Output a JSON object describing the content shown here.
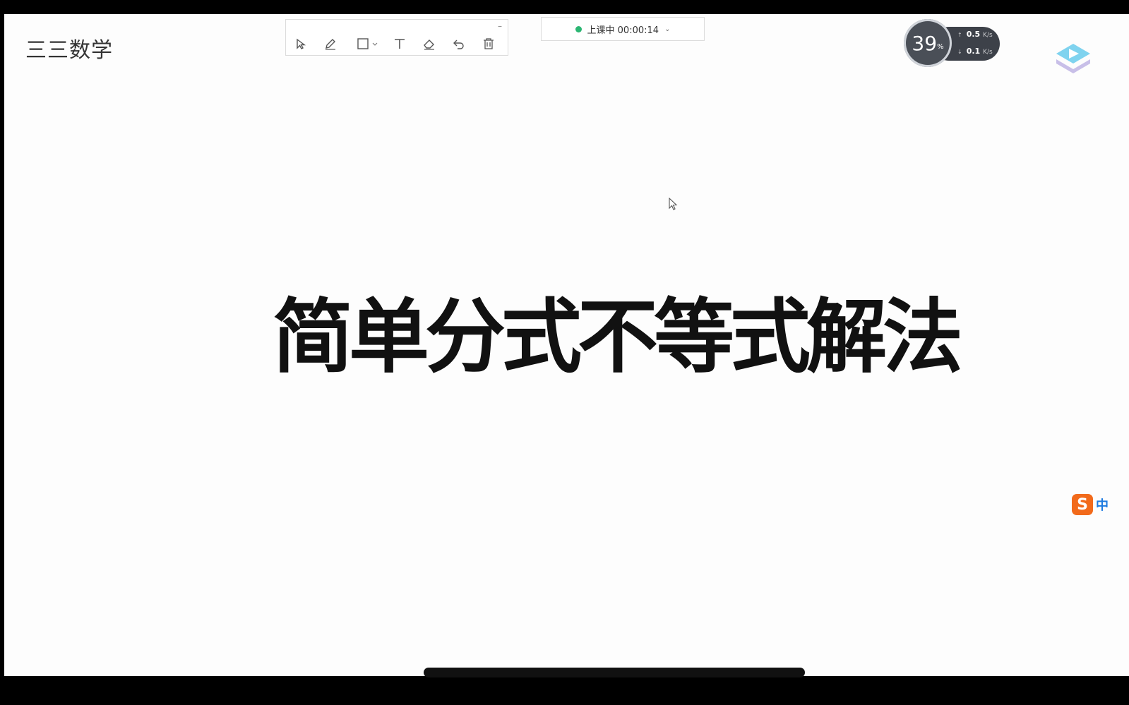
{
  "app": {
    "brand": "三三数学",
    "slide_title": "简单分式不等式解法"
  },
  "toolbar": {
    "collapse_label": "–",
    "tools": [
      {
        "name": "select-tool",
        "icon": "pointer-icon"
      },
      {
        "name": "pen-tool",
        "icon": "pencil-icon"
      },
      {
        "name": "shape-tool",
        "icon": "rectangle-icon"
      },
      {
        "name": "text-tool",
        "icon": "text-icon"
      },
      {
        "name": "eraser-tool",
        "icon": "eraser-icon"
      },
      {
        "name": "undo-tool",
        "icon": "undo-icon"
      },
      {
        "name": "delete-tool",
        "icon": "trash-icon"
      }
    ]
  },
  "status": {
    "label": "上课中 00:00:14",
    "dot_color": "#2bb673"
  },
  "network": {
    "percent": "39",
    "percent_unit": "%",
    "upload": "0.5",
    "download": "0.1",
    "unit": "K/s"
  },
  "ime": {
    "logo": "S",
    "mode": "中"
  }
}
